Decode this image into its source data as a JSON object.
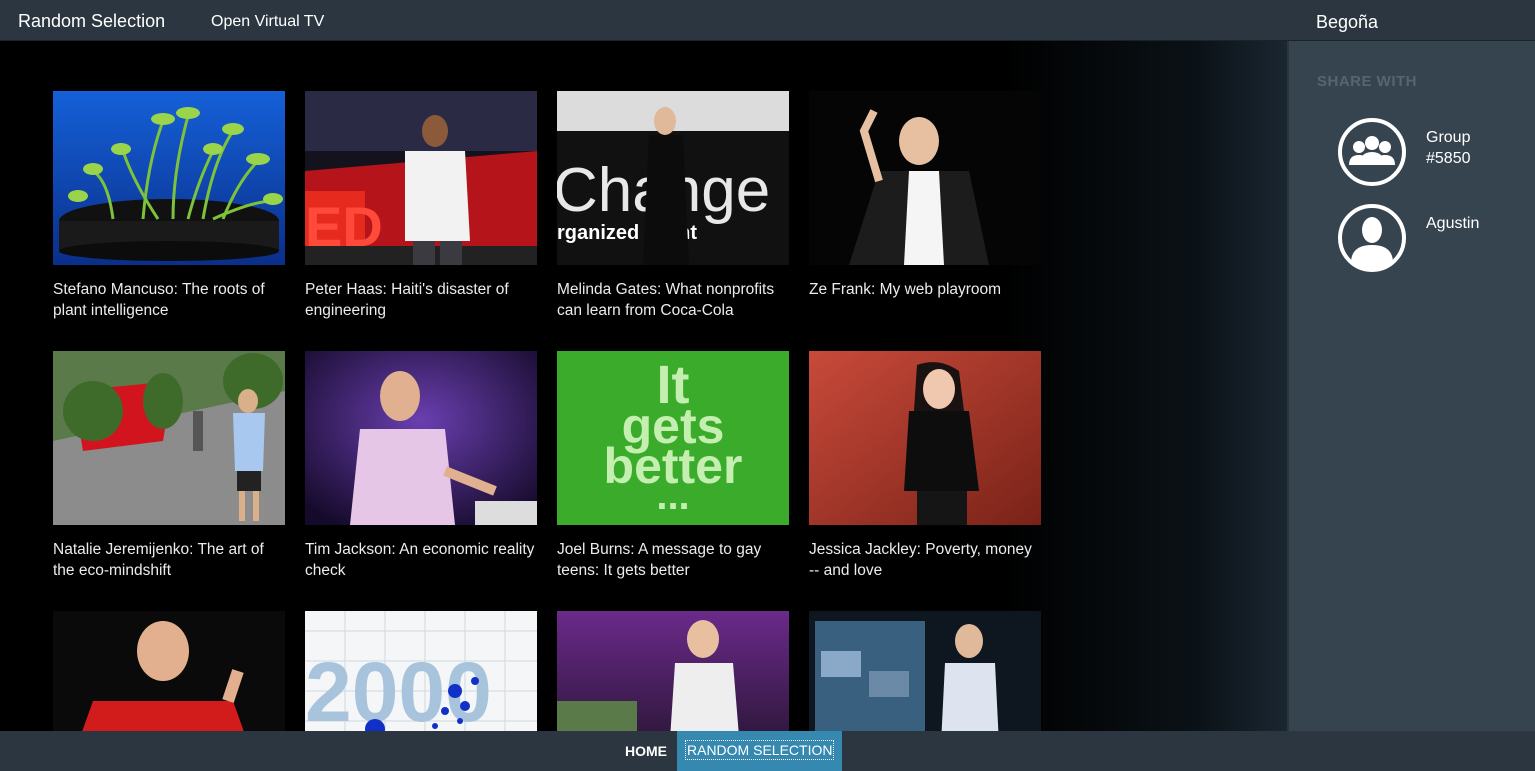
{
  "header": {
    "app_title": "Random Selection",
    "nav_link": "Open Virtual TV",
    "user_name": "Begoña"
  },
  "videos": [
    {
      "title": "Stefano Mancuso: The roots of plant intelligence",
      "thumb": "sprouts-thumbnail"
    },
    {
      "title": "Peter Haas: Haiti's disaster of engineering",
      "thumb": "speaker-ted-stage-thumbnail"
    },
    {
      "title": "Melinda Gates: What nonprofits can learn from Coca-Cola",
      "thumb": "speaker-change-screen-thumbnail",
      "screen_text_1": "Change",
      "screen_text_2": "rganized event"
    },
    {
      "title": "Ze Frank: My web playroom",
      "thumb": "speaker-dark-thumbnail"
    },
    {
      "title": "Natalie Jeremijenko: The art of the eco-mindshift",
      "thumb": "street-garden-thumbnail"
    },
    {
      "title": "Tim Jackson: An economic reality check",
      "thumb": "speaker-purple-thumbnail"
    },
    {
      "title": "Joel Burns: A message to gay teens: It gets better",
      "thumb": "it-gets-better-thumbnail",
      "poster_lines": [
        "It",
        "gets",
        "better",
        "..."
      ]
    },
    {
      "title": "Jessica Jackley: Poverty, money -- and love",
      "thumb": "speaker-red-stage-thumbnail"
    },
    {
      "title": "",
      "thumb": "speaker-red-shirt-thumbnail"
    },
    {
      "title": "",
      "thumb": "chart-2000-thumbnail",
      "chart_text": "2000"
    },
    {
      "title": "",
      "thumb": "speaker-white-jacket-thumbnail"
    },
    {
      "title": "",
      "thumb": "speaker-screens-thumbnail"
    }
  ],
  "sidebar": {
    "heading": "SHARE WITH",
    "targets": [
      {
        "label": "Group #5850",
        "icon": "group-icon"
      },
      {
        "label": "Agustin",
        "icon": "person-icon"
      }
    ]
  },
  "footer": {
    "home_label": "HOME",
    "random_label": "RANDOM SELECTION"
  },
  "colors": {
    "bar_bg": "#2b3640",
    "sidebar_bg": "#36444f",
    "active_button": "#3589b0",
    "poster_green": "#3aab2a",
    "ted_red": "#e62b1e"
  }
}
